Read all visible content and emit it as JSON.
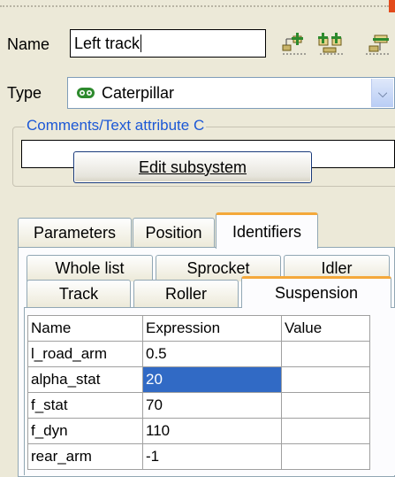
{
  "name": {
    "label": "Name",
    "value": "Left track"
  },
  "toolbar": {
    "icons": [
      "add-child-icon",
      "add-sibling-icon",
      "remove-icon"
    ]
  },
  "type": {
    "label": "Type",
    "value": "Caterpillar",
    "icon": "caterpillar-icon"
  },
  "comments": {
    "title": "Comments/Text attribute C",
    "value": ""
  },
  "edit_button": {
    "label": "Edit subsystem"
  },
  "top_tabs": [
    "Parameters",
    "Position",
    "Identifiers"
  ],
  "top_tabs_active": "Identifiers",
  "sub_tabs_row1": [
    "Whole list",
    "Sprocket",
    "Idler"
  ],
  "sub_tabs_row2": [
    "Track",
    "Roller",
    "Suspension"
  ],
  "sub_tabs_active": "Suspension",
  "table": {
    "headers": [
      "Name",
      "Expression",
      "Value"
    ],
    "rows": [
      {
        "name": "l_road_arm",
        "expression": "0.5",
        "value": ""
      },
      {
        "name": "alpha_stat",
        "expression": "20",
        "value": ""
      },
      {
        "name": "f_stat",
        "expression": "70",
        "value": ""
      },
      {
        "name": "f_dyn",
        "expression": "110",
        "value": ""
      },
      {
        "name": "rear_arm",
        "expression": "-1",
        "value": ""
      }
    ],
    "selected_row": 1
  },
  "colors": {
    "accent": "#316ac5",
    "tab_highlight": "#f4a83a",
    "group_title": "#1c58d6",
    "icon_green": "#2d8a2d"
  }
}
